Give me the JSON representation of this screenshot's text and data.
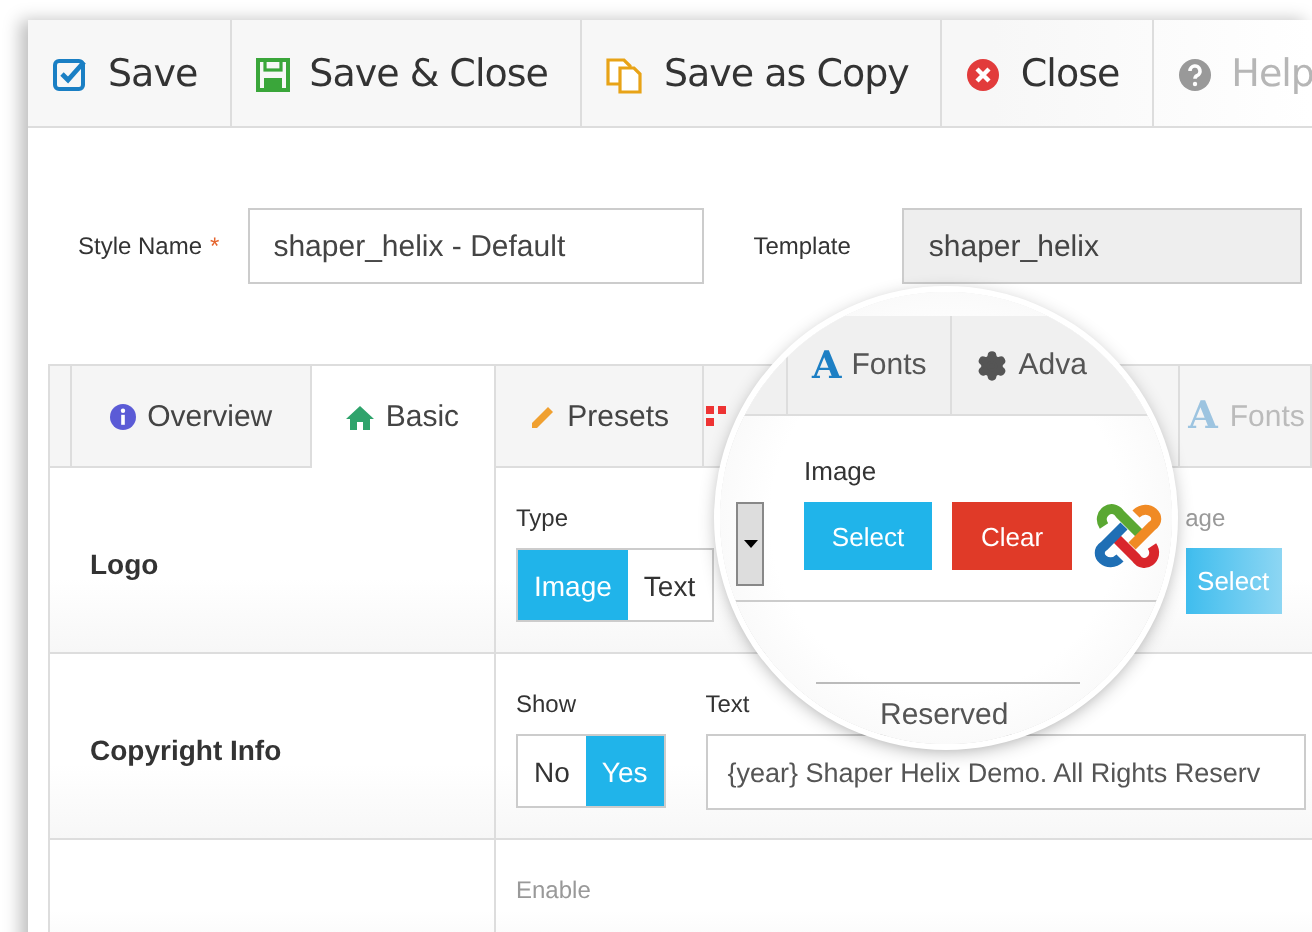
{
  "toolbar": [
    {
      "kind": "save",
      "label": "Save"
    },
    {
      "kind": "save-close",
      "label": "Save & Close"
    },
    {
      "kind": "copy",
      "label": "Save as Copy"
    },
    {
      "kind": "close",
      "label": "Close"
    },
    {
      "kind": "help",
      "label": "Help",
      "disabled": true
    }
  ],
  "style_name": {
    "label": "Style Name",
    "required_mark": "*",
    "value": "shaper_helix - Default"
  },
  "template": {
    "label": "Template",
    "value": "shaper_helix"
  },
  "tabs": [
    {
      "kind": "info",
      "label": "Overview",
      "selected": false
    },
    {
      "kind": "home",
      "label": "Basic",
      "selected": true
    },
    {
      "kind": "pencil",
      "label": "Presets",
      "selected": false
    },
    {
      "kind": "grid",
      "selected": false
    },
    {
      "kind": "fonts",
      "icon_text": "A",
      "label": "Fonts",
      "selected": false,
      "faded": true
    }
  ],
  "rows": [
    {
      "kind": "logo",
      "label": "Logo",
      "type_label": "Type",
      "options": [
        {
          "label": "Image",
          "selected": true
        },
        {
          "label": "Text",
          "selected": false
        }
      ],
      "image_label": "age",
      "select_label": "Select"
    },
    {
      "kind": "copyright",
      "label": "Copyright Info",
      "show_label": "Show",
      "options": [
        {
          "label": "No",
          "selected": false
        },
        {
          "label": "Yes",
          "selected": true
        }
      ],
      "text_label": "Text",
      "text_value": "{year} Shaper Helix Demo. All Rights Reserv"
    },
    {
      "kind": "plain",
      "field_label": "Enable"
    }
  ],
  "magnifier": {
    "tabs": [
      {
        "kind": "fonts",
        "icon_text": "A",
        "label": "Fonts"
      },
      {
        "kind": "gear",
        "label": "Adva"
      }
    ],
    "image_label": "Image",
    "select_label": "Select",
    "clear_label": "Clear",
    "footer_text": "Reserved"
  }
}
